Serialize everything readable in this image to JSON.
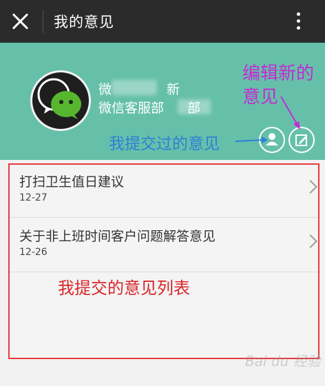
{
  "titlebar": {
    "title": "我的意见"
  },
  "profile": {
    "name_prefix": "微",
    "name_suffix": "新",
    "dept_prefix": "微信客服部",
    "dept_suffix": "部"
  },
  "annotations": {
    "edit_new_line1": "编辑新的",
    "edit_new_line2": "意见",
    "my_submitted": "我提交过的意见",
    "list_note": "我提交的意见列表"
  },
  "feedback_list": [
    {
      "title": "打扫卫生值日建议",
      "date": "12-27"
    },
    {
      "title": "关于非上班时间客户问题解答意见",
      "date": "12-26"
    }
  ],
  "watermark": "Bai du 经验",
  "colors": {
    "titlebar": "#2b2b2b",
    "header": "#66c0a9",
    "annotation_purple": "#c32ad5",
    "annotation_blue": "#2e7fd8",
    "annotation_red": "#d9262a"
  }
}
